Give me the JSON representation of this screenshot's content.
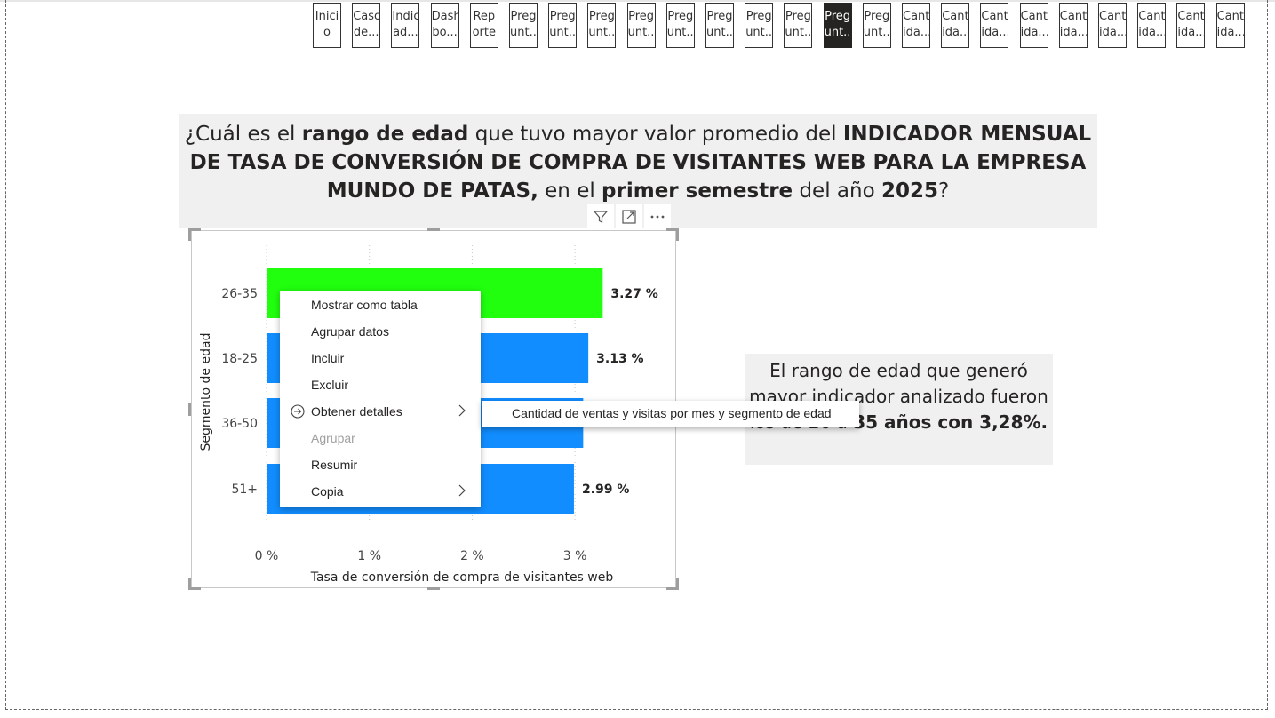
{
  "nav_tabs": [
    {
      "line1": "Inici",
      "line2": "o",
      "active": false
    },
    {
      "line1": "Caso",
      "line2": "de...",
      "active": false
    },
    {
      "line1": "Indic",
      "line2": "ad...",
      "active": false
    },
    {
      "line1": "Dash",
      "line2": "bo...",
      "active": false
    },
    {
      "line1": "Rep",
      "line2": "orte",
      "active": false
    },
    {
      "line1": "Preg",
      "line2": "unt...",
      "active": false
    },
    {
      "line1": "Preg",
      "line2": "unt...",
      "active": false
    },
    {
      "line1": "Preg",
      "line2": "unt...",
      "active": false
    },
    {
      "line1": "Preg",
      "line2": "unt...",
      "active": false
    },
    {
      "line1": "Preg",
      "line2": "unt...",
      "active": false
    },
    {
      "line1": "Preg",
      "line2": "unt...",
      "active": false
    },
    {
      "line1": "Preg",
      "line2": "unt...",
      "active": false
    },
    {
      "line1": "Preg",
      "line2": "unt...",
      "active": false
    },
    {
      "line1": "Preg",
      "line2": "unt...",
      "active": true
    },
    {
      "line1": "Preg",
      "line2": "unt...",
      "active": false
    },
    {
      "line1": "Cant",
      "line2": "ida...",
      "active": false
    },
    {
      "line1": "Cant",
      "line2": "ida...",
      "active": false
    },
    {
      "line1": "Cant",
      "line2": "ida...",
      "active": false
    },
    {
      "line1": "Cant",
      "line2": "ida...",
      "active": false
    },
    {
      "line1": "Cant",
      "line2": "ida...",
      "active": false
    },
    {
      "line1": "Cant",
      "line2": "ida...",
      "active": false
    },
    {
      "line1": "Cant",
      "line2": "ida...",
      "active": false
    },
    {
      "line1": "Cant",
      "line2": "ida...",
      "active": false
    },
    {
      "line1": "Cant",
      "line2": "ida...",
      "active": false
    }
  ],
  "question": {
    "t1": "¿Cuál es el ",
    "b1": "rango de edad",
    "t2": " que tuvo mayor valor promedio del ",
    "b2": "INDICADOR MENSUAL DE TASA DE CONVERSIÓN DE COMPRA DE VISITANTES WEB PARA LA EMPRESA MUNDO DE PATAS,",
    "t3": " en el ",
    "b3": "primer semestre",
    "t4": " del año ",
    "b4": "2025",
    "t5": "?"
  },
  "visual_header": {
    "filter_icon": "filter-icon",
    "focus_icon": "focus-mode-icon",
    "more_icon": "more-options-icon"
  },
  "chart_data": {
    "type": "bar",
    "orientation": "horizontal",
    "categories": [
      "26-35",
      "18-25",
      "36-50",
      "51+"
    ],
    "values": [
      3.27,
      3.13,
      3.08,
      2.99
    ],
    "data_labels": [
      "3.27 %",
      "3.13 %",
      "3.08 %",
      "2.99 %"
    ],
    "colors": [
      "#21ff0f",
      "#118dff",
      "#118dff",
      "#118dff"
    ],
    "xlabel": "Tasa de conversión de compra de visitantes web",
    "ylabel": "Segmento de edad",
    "x_ticks": [
      "0 %",
      "1 %",
      "2 %",
      "3 %"
    ],
    "xlim": [
      0,
      3.5
    ],
    "grid": true
  },
  "answer": {
    "t1": "El rango de edad que generó mayor indicador analizado fueron los de 26 a ",
    "b1": "35 años con 3,28%."
  },
  "context_menu": {
    "items": [
      {
        "label": "Mostrar como tabla",
        "disabled": false,
        "submenu": false
      },
      {
        "label": "Agrupar datos",
        "disabled": false,
        "submenu": false
      },
      {
        "label": "Incluir",
        "disabled": false,
        "submenu": false
      },
      {
        "label": "Excluir",
        "disabled": false,
        "submenu": false
      },
      {
        "label": "Obtener detalles",
        "disabled": false,
        "submenu": true,
        "icon": "drillthrough-icon"
      },
      {
        "label": "Agrupar",
        "disabled": true,
        "submenu": false
      },
      {
        "label": "Resumir",
        "disabled": false,
        "submenu": false
      },
      {
        "label": "Copia",
        "disabled": false,
        "submenu": true
      }
    ],
    "submenu_item": "Cantidad de ventas y visitas por mes y segmento de edad"
  }
}
